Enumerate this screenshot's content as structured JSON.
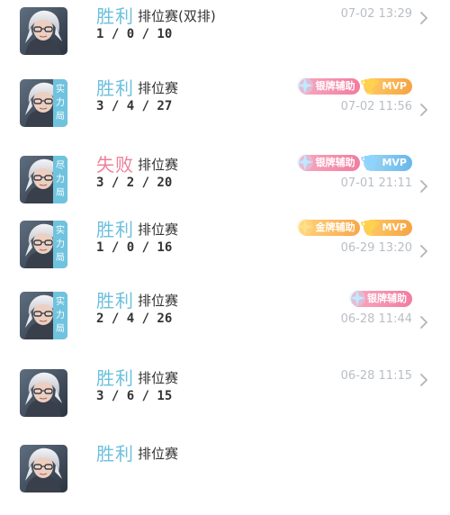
{
  "matches": [
    {
      "tag": [],
      "result": "胜利",
      "result_type": "win",
      "mode": "排位赛(双排)",
      "kda": "1 / 0 / 10",
      "time": "07-02 13:29",
      "badges": []
    },
    {
      "tag": [
        "实",
        "力",
        "局"
      ],
      "result": "胜利",
      "result_type": "win",
      "mode": "排位赛",
      "kda": "3 / 4 / 27",
      "time": "07-02 11:56",
      "badges": [
        {
          "label": "银牌辅助",
          "style": "silver"
        },
        {
          "label": "MVP",
          "style": "mvp-gold"
        }
      ]
    },
    {
      "tag": [
        "尽",
        "力",
        "局"
      ],
      "result": "失败",
      "result_type": "lose",
      "mode": "排位赛",
      "kda": "3 / 2 / 20",
      "time": "07-01 21:11",
      "badges": [
        {
          "label": "银牌辅助",
          "style": "silver"
        },
        {
          "label": "MVP",
          "style": "mvp-blue"
        }
      ]
    },
    {
      "tag": [
        "实",
        "力",
        "局"
      ],
      "result": "胜利",
      "result_type": "win",
      "mode": "排位赛",
      "kda": "1 / 0 / 16",
      "time": "06-29 13:20",
      "badges": [
        {
          "label": "金牌辅助",
          "style": "gold"
        },
        {
          "label": "MVP",
          "style": "mvp-gold"
        }
      ]
    },
    {
      "tag": [
        "实",
        "力",
        "局"
      ],
      "result": "胜利",
      "result_type": "win",
      "mode": "排位赛",
      "kda": "2 / 4 / 26",
      "time": "06-28 11:44",
      "badges": [
        {
          "label": "银牌辅助",
          "style": "silver"
        }
      ]
    },
    {
      "tag": [],
      "result": "胜利",
      "result_type": "win",
      "mode": "排位赛",
      "kda": "3 / 6 / 15",
      "time": "06-28 11:15",
      "badges": []
    },
    {
      "tag": [],
      "result": "胜利",
      "result_type": "win",
      "mode": "排位赛",
      "kda": "",
      "time": "",
      "badges": []
    }
  ],
  "colors": {
    "win": "#6cc0dd",
    "lose": "#ee7f99",
    "tag_bg": "#6fc3df",
    "time": "#b9bec4",
    "chevron": "#b0b4b8"
  },
  "icons": {
    "chevron": "chevron-right-icon",
    "avatar": "hero-avatar",
    "badge_support": "star-burst-icon",
    "badge_mvp": "trophy-icon"
  }
}
